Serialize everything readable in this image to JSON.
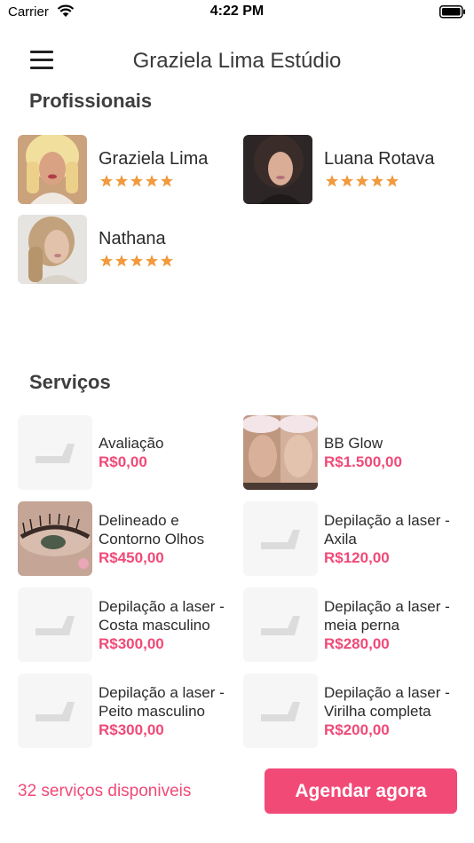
{
  "status_bar": {
    "carrier": "Carrier",
    "time": "4:22 PM"
  },
  "header": {
    "title": "Graziela Lima Estúdio",
    "menu_icon": "hamburger-menu-icon"
  },
  "professionals": {
    "title": "Profissionais",
    "items": [
      {
        "name": "Graziela Lima",
        "rating": 5
      },
      {
        "name": "Luana Rotava",
        "rating": 5
      },
      {
        "name": "Nathana",
        "rating": 5
      }
    ]
  },
  "services": {
    "title": "Serviços",
    "items": [
      {
        "name": "Avaliação",
        "price": "R$0,00",
        "thumb": "placeholder"
      },
      {
        "name": "BB Glow",
        "price": "R$1.500,00",
        "thumb": "photo"
      },
      {
        "name": "Delineado e Contorno Olhos",
        "price": "R$450,00",
        "thumb": "photo"
      },
      {
        "name": "Depilação a laser - Axila",
        "price": "R$120,00",
        "thumb": "placeholder"
      },
      {
        "name": "Depilação a laser - Costa masculino",
        "price": "R$300,00",
        "thumb": "placeholder"
      },
      {
        "name": "Depilação a laser - meia perna",
        "price": "R$280,00",
        "thumb": "placeholder"
      },
      {
        "name": "Depilação a laser - Peito masculino",
        "price": "R$300,00",
        "thumb": "placeholder"
      },
      {
        "name": "Depilação a laser - Virilha completa",
        "price": "R$200,00",
        "thumb": "placeholder"
      }
    ]
  },
  "footer": {
    "count_text": "32 serviços disponiveis",
    "book_label": "Agendar agora"
  },
  "colors": {
    "accent": "#f24a77",
    "price": "#f04a78",
    "star": "#f19a3e"
  }
}
